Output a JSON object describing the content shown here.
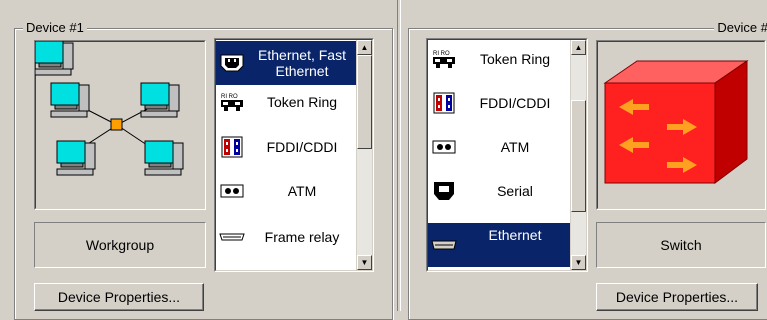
{
  "device1": {
    "title": "Device #1",
    "type_label": "Workgroup",
    "properties_button": "Device Properties...",
    "list_items": [
      {
        "label": "Ethernet, Fast Ethernet",
        "icon": "ethernet-port-icon",
        "selected": true
      },
      {
        "label": "Token Ring",
        "icon": "token-ring-icon",
        "selected": false
      },
      {
        "label": "FDDI/CDDI",
        "icon": "fddi-icon",
        "selected": false
      },
      {
        "label": "ATM",
        "icon": "atm-icon",
        "selected": false
      },
      {
        "label": "Frame relay",
        "icon": "frame-relay-icon",
        "selected": false
      }
    ]
  },
  "device2": {
    "title": "Device #",
    "type_label": "Switch",
    "properties_button": "Device Properties...",
    "list_items": [
      {
        "label": "Token Ring",
        "icon": "token-ring-icon",
        "selected": false
      },
      {
        "label": "FDDI/CDDI",
        "icon": "fddi-icon",
        "selected": false
      },
      {
        "label": "ATM",
        "icon": "atm-icon",
        "selected": false
      },
      {
        "label": "Serial",
        "icon": "serial-port-icon",
        "selected": false
      },
      {
        "label": "Ethernet",
        "icon": "ethernet-port-icon",
        "selected": true
      }
    ]
  },
  "icon_labels": {
    "token_ring": "RI RO"
  },
  "colors": {
    "selection": "#0a246a",
    "switch_red": "#ff2020",
    "arrow_orange": "#ffa020",
    "monitor_cyan": "#00e0e0",
    "hub_orange": "#ffa000"
  }
}
